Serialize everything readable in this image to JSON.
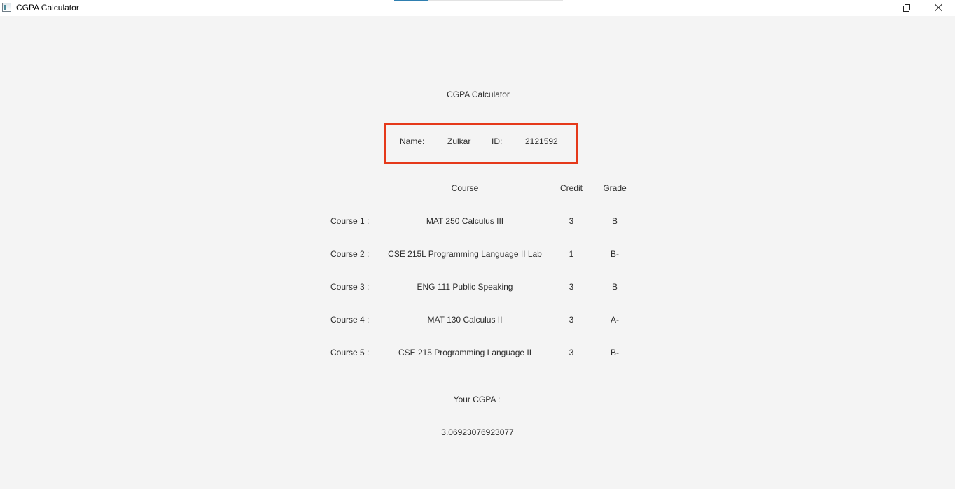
{
  "window": {
    "title": "CGPA Calculator"
  },
  "header": {
    "heading": "CGPA Calculator"
  },
  "student": {
    "name_label": "Name:",
    "name_value": "Zulkar",
    "id_label": "ID:",
    "id_value": "2121592"
  },
  "table": {
    "columns": {
      "course": "Course",
      "credit": "Credit",
      "grade": "Grade"
    },
    "rows": [
      {
        "label": "Course 1 :",
        "course": "MAT 250 Calculus III",
        "credit": "3",
        "grade": "B"
      },
      {
        "label": "Course 2 :",
        "course": "CSE 215L Programming Language II Lab",
        "credit": "1",
        "grade": "B-"
      },
      {
        "label": "Course 3 :",
        "course": "ENG 111 Public Speaking",
        "credit": "3",
        "grade": "B"
      },
      {
        "label": "Course 4 :",
        "course": "MAT 130 Calculus II",
        "credit": "3",
        "grade": "A-"
      },
      {
        "label": "Course 5 :",
        "course": "CSE 215 Programming Language II",
        "credit": "3",
        "grade": "B-"
      }
    ]
  },
  "result": {
    "label": "Your CGPA :",
    "value": "3.06923076923077"
  },
  "colors": {
    "highlight_border": "#e5391a",
    "background": "#f4f4f4"
  }
}
